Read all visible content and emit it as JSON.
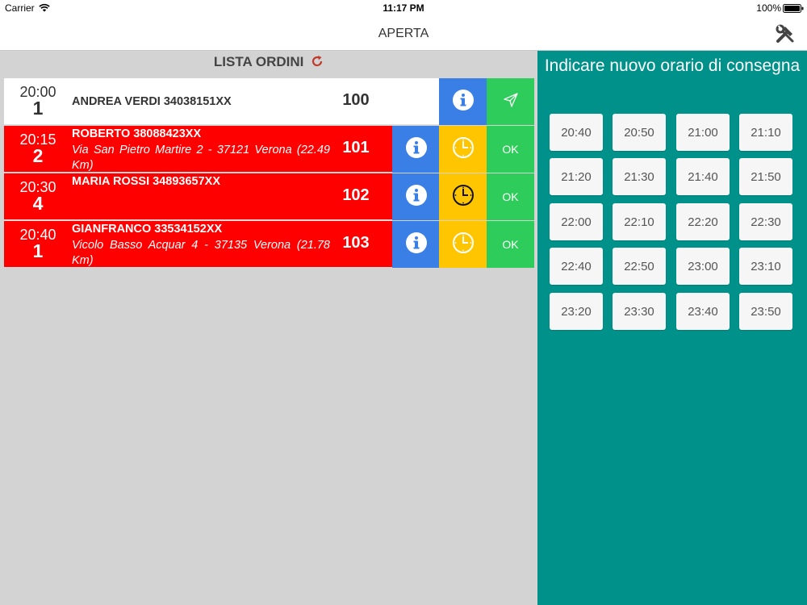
{
  "status_bar": {
    "carrier": "Carrier",
    "time": "11:17 PM",
    "battery": "100%"
  },
  "nav": {
    "title": "APERTA"
  },
  "list": {
    "header": "LISTA ORDINI",
    "orders": [
      {
        "time": "20:00",
        "qty": "1",
        "customer": "ANDREA VERDI 34038151XX",
        "address": "",
        "number": "100",
        "style": "white",
        "action": "send"
      },
      {
        "time": "20:15",
        "qty": "2",
        "customer": "ROBERTO 38088423XX",
        "address": "Via San Pietro Martire 2 - 37121 Verona (22.49 Km)",
        "number": "101",
        "style": "red",
        "action": "ok",
        "ok_label": "OK"
      },
      {
        "time": "20:30",
        "qty": "4",
        "customer": "MARIA ROSSI 34893657XX",
        "address": "",
        "number": "102",
        "style": "red",
        "action": "ok",
        "ok_label": "OK"
      },
      {
        "time": "20:40",
        "qty": "1",
        "customer": "GIANFRANCO 33534152XX",
        "address": "Vicolo Basso Acquar 4 - 37135 Verona (21.78 Km)",
        "number": "103",
        "style": "red",
        "action": "ok",
        "ok_label": "OK"
      }
    ]
  },
  "delivery": {
    "title": "Indicare nuovo orario di consegna",
    "slots": [
      "20:40",
      "20:50",
      "21:00",
      "21:10",
      "21:20",
      "21:30",
      "21:40",
      "21:50",
      "22:00",
      "22:10",
      "22:20",
      "22:30",
      "22:40",
      "22:50",
      "23:00",
      "23:10",
      "23:20",
      "23:30",
      "23:40",
      "23:50"
    ]
  },
  "colors": {
    "red_row": "#ff0000",
    "info_button": "#3a7fe6",
    "clock_button": "#ffc600",
    "ok_button": "#2ecc5a",
    "right_panel": "#00918a"
  },
  "icons": {
    "status": [
      "wifi-icon",
      "battery-icon"
    ],
    "nav": "tools-icon",
    "list_header": "refresh-icon",
    "row_buttons": [
      "info-icon",
      "clock-icon",
      "send-icon"
    ]
  }
}
